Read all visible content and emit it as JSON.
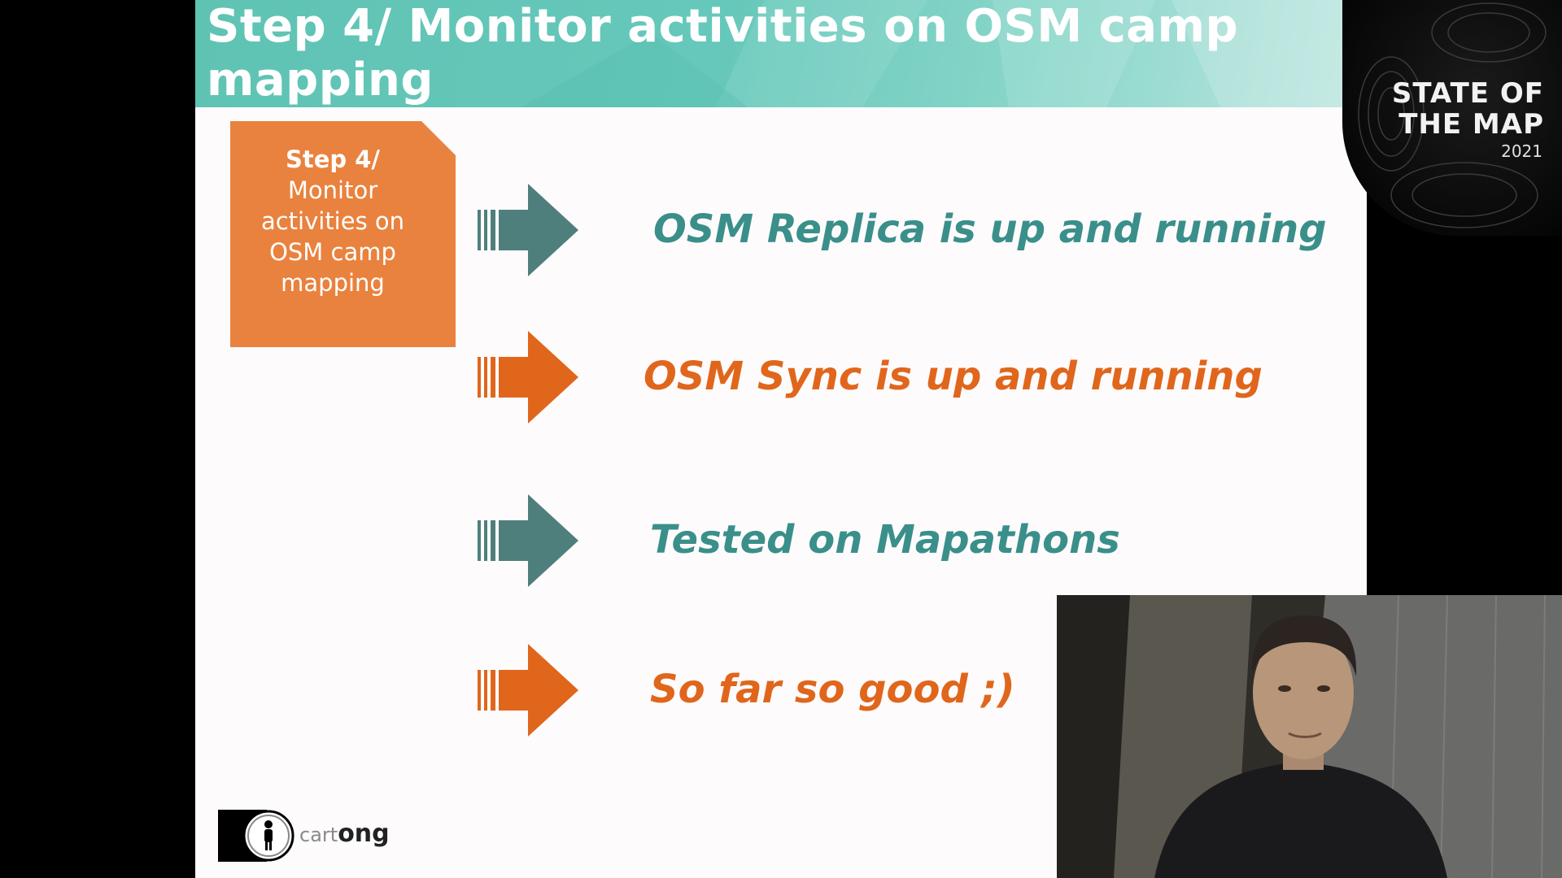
{
  "slide": {
    "title": "Step 4/ Monitor activities on OSM camp mapping",
    "step_box": {
      "title": "Step 4/",
      "body": "Monitor\nactivities on\nOSM camp\nmapping"
    },
    "rows": [
      {
        "text": "OSM Replica is up and running",
        "color": "#3a8f8a",
        "arrow": "teal-arrow-icon"
      },
      {
        "text": "OSM Sync is up and running",
        "color": "#e0661c",
        "arrow": "orange-arrow-icon"
      },
      {
        "text": "Tested on Mapathons",
        "color": "#3a8f8a",
        "arrow": "teal-arrow-icon"
      },
      {
        "text": "So far so good ;)",
        "color": "#e0661c",
        "arrow": "orange-arrow-icon"
      }
    ],
    "logo": {
      "light": "cart",
      "bold": "ong"
    }
  },
  "badge": {
    "line1": "STATE OF",
    "line2": "THE MAP",
    "year": "2021"
  },
  "colors": {
    "header_teal": "#66c8ba",
    "step_orange": "#e9823e",
    "arrow_teal": "#4f7f7c",
    "arrow_orange": "#e0661c"
  }
}
